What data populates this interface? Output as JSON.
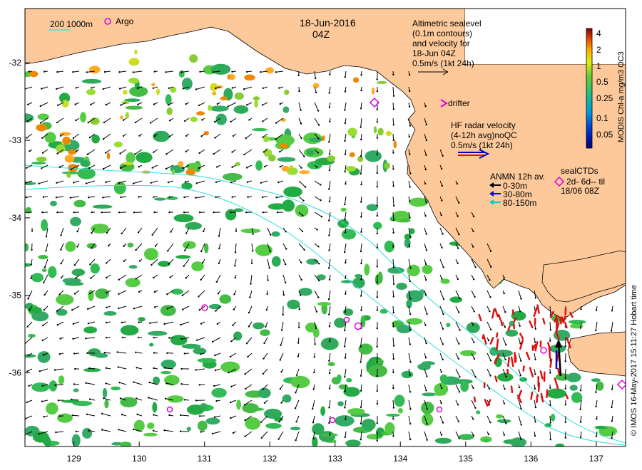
{
  "title": {
    "date": "18-Jun-2016",
    "time": "04Z"
  },
  "scale_bar": {
    "label": "200  1000m"
  },
  "argo_label": "Argo",
  "altimetry": {
    "lines": [
      "Altimetric sealevel",
      "(0.1m contours)",
      "and velocity for",
      "18-Jun 04Z"
    ],
    "speed": "0.5m/s (1kt 24h)"
  },
  "drifter_label": "drifter",
  "hf_radar": {
    "lines": [
      "HF radar velocity",
      "(4-12h avg)noQC"
    ],
    "speed": "0.5m/s (1kt 24h)"
  },
  "anmn": {
    "title": "ANMN 12h av.",
    "items": [
      {
        "label": "0-30m",
        "color": "#000000"
      },
      {
        "label": "30-80m",
        "color": "#0000cc"
      },
      {
        "label": "80-150m",
        "color": "#00cccc"
      }
    ]
  },
  "sealctd": {
    "lines": [
      "sealCTDs",
      "2d- 6d-- til",
      "18/06 08Z"
    ]
  },
  "colorbar": {
    "label": "MODIS Chl-a mg/m3 OC3",
    "ticks": [
      "4",
      "2",
      "1",
      "0.5",
      "0.25",
      "0.1",
      "0.05"
    ]
  },
  "credit": "© IMOS 16-May-2017 15:11:27 Hobart time",
  "axes": {
    "x_ticks": [
      "129",
      "130",
      "131",
      "132",
      "133",
      "134",
      "135",
      "136",
      "137"
    ],
    "y_ticks": [
      "-32",
      "-33",
      "-34",
      "-35",
      "-36"
    ]
  },
  "colors": {
    "land": "#fdc99a",
    "chl_low": "#22aa44",
    "chl_mid": "#99dd33",
    "chl_high": "#ff8800",
    "radar_vectors": "#dd1111",
    "argo": "#dd00dd",
    "isobath": "#33dddd"
  }
}
